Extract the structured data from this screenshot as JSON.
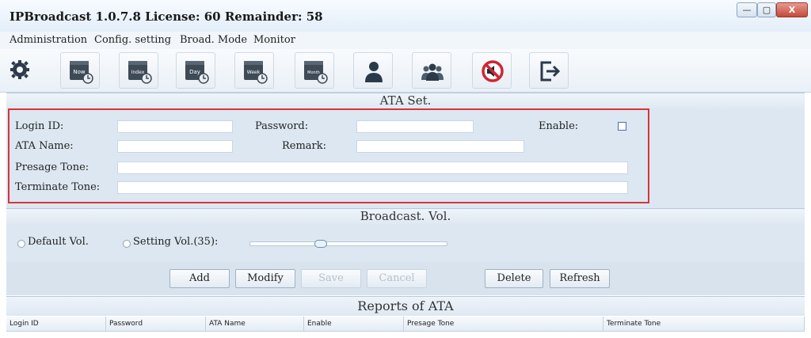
{
  "window": {
    "title": "IPBroadcast 1.0.7.8 License: 60 Remainder: 58",
    "controls": {
      "minimize": "—",
      "maximize": "▢",
      "close": "X"
    }
  },
  "menu": [
    "Administration",
    "Config. setting",
    "Broad. Mode",
    "Monitor"
  ],
  "toolbar": {
    "icons": [
      "gear-icon",
      "calendar-now-icon",
      "calendar-index-icon",
      "calendar-day-icon",
      "calendar-week-icon",
      "calendar-month-icon",
      "user-icon",
      "users-group-icon",
      "mute-icon",
      "exit-icon"
    ],
    "calendar_labels": [
      "Now",
      "Index",
      "Day",
      "Week",
      "Month"
    ]
  },
  "ata_set": {
    "title": "ATA Set.",
    "login_id_label": "Login ID:",
    "login_id_value": "",
    "password_label": "Password:",
    "password_value": "",
    "enable_label": "Enable:",
    "enable_checked": false,
    "ata_name_label": "ATA Name:",
    "ata_name_value": "",
    "remark_label": "Remark:",
    "remark_value": "",
    "presage_label": "Presage Tone:",
    "presage_value": "",
    "terminate_label": "Terminate Tone:",
    "terminate_value": ""
  },
  "broadcast_vol": {
    "title": "Broadcast. Vol.",
    "default_label": "Default Vol.",
    "setting_label": "Setting Vol.(35):",
    "volume_fraction": 0.35
  },
  "actions": {
    "add": "Add",
    "modify": "Modify",
    "save": "Save",
    "cancel": "Cancel",
    "delete": "Delete",
    "refresh": "Refresh"
  },
  "reports": {
    "title": "Reports of ATA",
    "columns": [
      "Login ID",
      "Password",
      "ATA Name",
      "Enable",
      "Presage Tone",
      "Terminate Tone"
    ]
  }
}
